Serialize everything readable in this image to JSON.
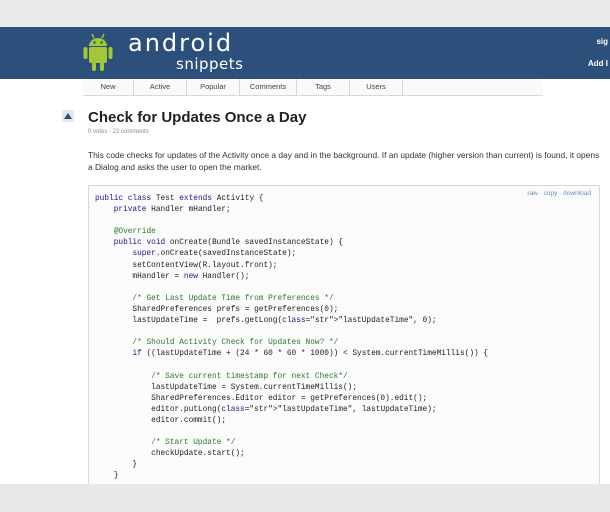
{
  "header": {
    "brand_title": "android",
    "brand_sub": "snippets",
    "link_top": "sig",
    "link_bottom": "Add I"
  },
  "nav": {
    "tabs": [
      {
        "label": "New"
      },
      {
        "label": "Active"
      },
      {
        "label": "Popular"
      },
      {
        "label": "Comments"
      },
      {
        "label": "Tags"
      },
      {
        "label": "Users"
      }
    ]
  },
  "snippet": {
    "title": "Check for Updates Once a Day",
    "meta": "0 votes · 22 comments",
    "description": "This code checks for updates of the Activity once a day and in the background. If an update (higher version than current) is found, it opens a Dialog and asks the user to open the market.",
    "tools": {
      "raw": "raw",
      "copy": "copy",
      "download": "download",
      "sep": " · "
    }
  },
  "code_lines": [
    "public class Test extends Activity {",
    "    private Handler mHandler;",
    "",
    "    @Override",
    "    public void onCreate(Bundle savedInstanceState) {",
    "        super.onCreate(savedInstanceState);",
    "        setContentView(R.layout.front);",
    "        mHandler = new Handler();",
    "",
    "        /* Get Last Update Time from Preferences */",
    "        SharedPreferences prefs = getPreferences(0);",
    "        lastUpdateTime =  prefs.getLong(\"lastUpdateTime\", 0);",
    "",
    "        /* Should Activity Check for Updates Now? */",
    "        if ((lastUpdateTime + (24 * 60 * 60 * 1000)) < System.currentTimeMillis()) {",
    "",
    "            /* Save current timestamp for next Check*/",
    "            lastUpdateTime = System.currentTimeMillis();",
    "            SharedPreferences.Editor editor = getPreferences(0).edit();",
    "            editor.putLong(\"lastUpdateTime\", lastUpdateTime);",
    "            editor.commit();",
    "",
    "            /* Start Update */",
    "            checkUpdate.start();",
    "        }",
    "    }"
  ],
  "colors": {
    "header_bg": "#2c4f7b",
    "android_green": "#a4c639",
    "keyword": "#1a1a8c",
    "comment": "#2a7a2a",
    "link": "#6c8dbb"
  },
  "icons": [
    "android-robot-icon",
    "upvote-arrow-icon"
  ]
}
